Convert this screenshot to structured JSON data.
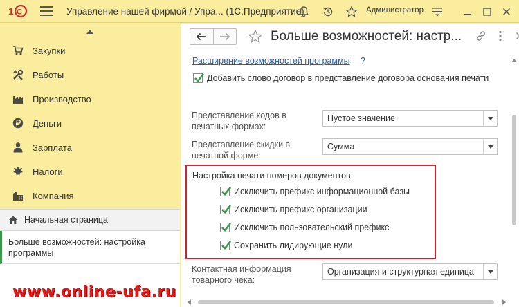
{
  "app": {
    "logo_text": "1С",
    "title": "Управление нашей фирмой / Упра...  (1С:Предприятие)",
    "user": "Администратор"
  },
  "colors": {
    "accent_yellow": "#fbed9e",
    "logo_red": "#d32f2f",
    "check_green": "#3a9a4b",
    "highlight_red": "#d2232a",
    "link_blue": "#2a5ba8"
  },
  "sidebar": {
    "items": [
      {
        "label": "Закупки",
        "icon": "cart-icon"
      },
      {
        "label": "Работы",
        "icon": "tools-icon"
      },
      {
        "label": "Производство",
        "icon": "factory-icon"
      },
      {
        "label": "Деньги",
        "icon": "ruble-coin-icon"
      },
      {
        "label": "Зарплата",
        "icon": "person-icon"
      },
      {
        "label": "Налоги",
        "icon": "emblem-icon"
      },
      {
        "label": "Компания",
        "icon": "buildings-icon"
      }
    ],
    "home_label": "Начальная страница",
    "open_window_label": "Больше возможностей: настройка программы"
  },
  "watermark": "www.online-ufa.ru",
  "form": {
    "title": "Больше возможностей: настр...",
    "link": "Расширение возможностей программы",
    "help": "?",
    "contract_checkbox": {
      "label": "Добавить слово договор в представление договора основания печати",
      "checked": true
    },
    "codes_field": {
      "label": "Представление кодов в печатных формах:",
      "value": "Пустое значение"
    },
    "discount_field": {
      "label": "Представление скидки в печатной форме:",
      "value": "Сумма"
    },
    "print_group": {
      "title": "Настройка печати номеров документов",
      "options": [
        {
          "label": "Исключить префикс информационной базы",
          "checked": true
        },
        {
          "label": "Исключить префикс организации",
          "checked": true
        },
        {
          "label": "Исключить пользовательский префикс",
          "checked": true
        },
        {
          "label": "Сохранить лидирующие нули",
          "checked": true
        }
      ]
    },
    "contact_field": {
      "label": "Контактная информация товарного чека:",
      "value": "Организация и структурная единица"
    }
  }
}
